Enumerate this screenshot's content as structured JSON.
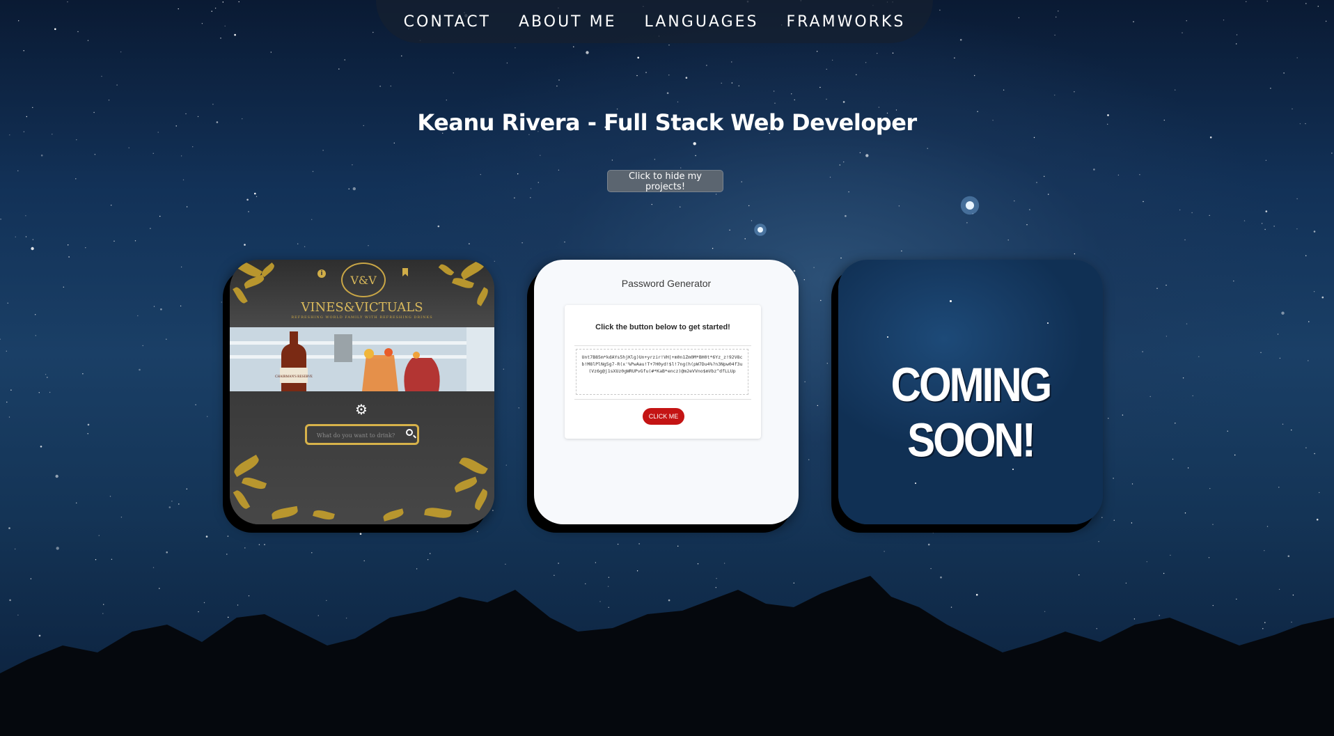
{
  "nav": {
    "items": [
      {
        "label": "CONTACT"
      },
      {
        "label": "ABOUT ME"
      },
      {
        "label": "LANGUAGES"
      },
      {
        "label": "FRAMWORKS"
      }
    ]
  },
  "header": {
    "title": "Keanu Rivera - Full Stack Web Developer",
    "toggle_label": "Click to hide my projects!"
  },
  "projects": {
    "vines": {
      "logo": "V&V",
      "brand": "VINES&VICTUALS",
      "tagline": "REFRESHING WORLD FAMILY WITH REFRESHING DRINKS",
      "bottle_label": "CHAIRMAN'S RESERVE",
      "search_placeholder": "What do you want to drink?"
    },
    "password_generator": {
      "title": "Password Generator",
      "prompt": "Click the button below to get started!",
      "generated_password": "Unt7B85m*kdAYs5hjKlg)Un+yrzir!VH|+m0n1Zm0M*BH0t*6Yz_z!92V8cb!M8lPlNg5g7-R(x'%PwAau!T+7H0yd!$l!7ng(h(pW7Du4%?n3Npw04f3u(Vz6g@j1sXUz0gWRUPvGfu(#*KaB*encz)@m2eVVno$mVbz^dfLLUp",
      "button_label": "CLICK ME"
    },
    "coming_soon": {
      "label": "COMING SOON!"
    }
  },
  "icons": {
    "info": "info-icon",
    "bookmark": "bookmark-icon",
    "gear": "gear-icon",
    "search": "search-icon"
  },
  "colors": {
    "accent_gold": "#d7b24a",
    "button_red": "#c41414"
  }
}
